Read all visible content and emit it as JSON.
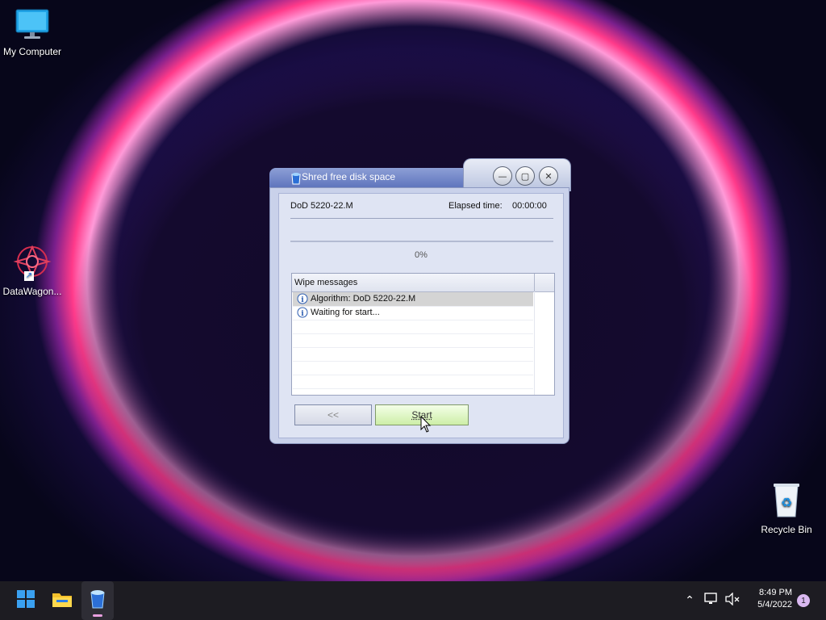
{
  "desktop": {
    "icons": [
      {
        "label": "My Computer"
      },
      {
        "label": "DataWagon..."
      },
      {
        "label": "Recycle Bin"
      }
    ]
  },
  "dialog": {
    "title": "Shred free disk space",
    "algorithm": "DoD 5220-22.M",
    "elapsed_label": "Elapsed time:",
    "elapsed_value": "00:00:00",
    "progress_text": "0%",
    "progress": 0,
    "messages_header": "Wipe messages",
    "messages": [
      {
        "text": "Algorithm: DoD 5220-22.M",
        "icon": "info-icon"
      },
      {
        "text": "Waiting for start...",
        "icon": "info-icon"
      }
    ],
    "back_button": "<<",
    "start_button": "Start"
  },
  "taskbar": {
    "time": "8:49 PM",
    "date": "5/4/2022",
    "notification_count": "1",
    "items": [
      "windows-start-icon",
      "file-explorer-icon",
      "shredder-app-icon"
    ]
  }
}
